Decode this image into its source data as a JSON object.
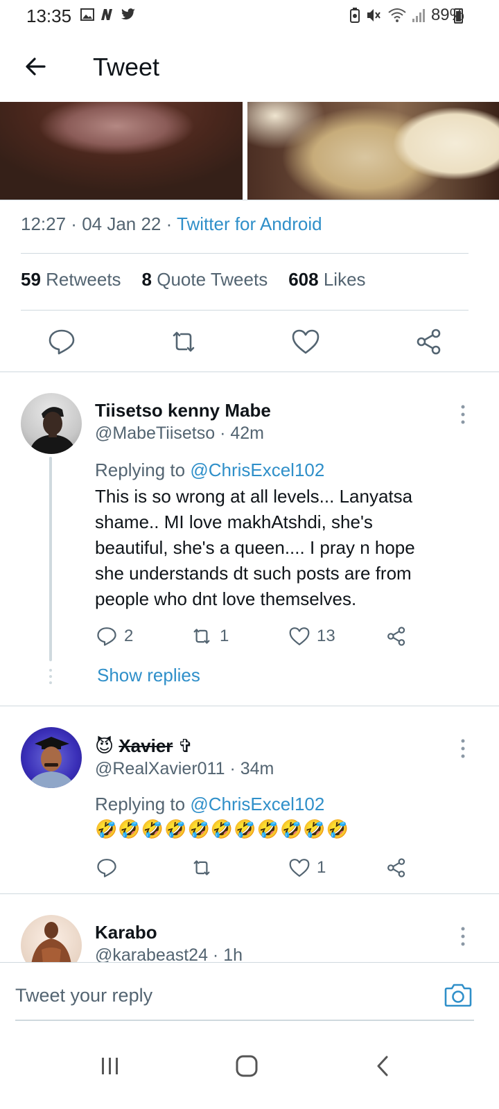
{
  "status_bar": {
    "time": "13:35",
    "battery_percent": "89%",
    "left_icons": [
      "gallery-icon",
      "n-app-icon",
      "twitter-bird-icon"
    ],
    "right_icons": [
      "battery-saver-icon",
      "mute-icon",
      "wifi-icon",
      "signal-icon",
      "battery-icon"
    ]
  },
  "app_bar": {
    "title": "Tweet",
    "back_icon": "arrow-left-icon"
  },
  "tweet": {
    "time": "12:27",
    "date": "04 Jan 22",
    "separator": " · ",
    "source": "Twitter for Android",
    "retweets_count": "59",
    "retweets_label": "Retweets",
    "quotes_count": "8",
    "quotes_label": "Quote Tweets",
    "likes_count": "608",
    "likes_label": "Likes",
    "actions": [
      "reply-icon",
      "retweet-icon",
      "like-icon",
      "share-icon"
    ]
  },
  "replies": [
    {
      "name": "Tiisetso kenny  Mabe",
      "handle": "@MabeTiisetso",
      "age": "42m",
      "replying_prefix": "Replying to ",
      "replying_to": "@ChrisExcel102",
      "text": "This is so wrong at all levels... Lanyatsa\nshame.. MI love makhAtshdi, she's\nbeautiful, she's a queen.... I pray n hope\nshe understands dt such posts are from\npeople who dnt love themselves.",
      "reply_count": "2",
      "retweet_count": "1",
      "like_count": "13",
      "show_replies": "Show replies"
    },
    {
      "name_emoji": "😈",
      "name": "Xavier",
      "name_suffix": "✞",
      "handle": "@RealXavier011",
      "age": "34m",
      "replying_prefix": "Replying to ",
      "replying_to": "@ChrisExcel102",
      "text": "🤣🤣🤣🤣🤣🤣🤣🤣🤣🤣🤣",
      "reply_count": "",
      "retweet_count": "",
      "like_count": "1"
    },
    {
      "name": "Karabo",
      "handle": "@karabeast24",
      "age": "1h"
    }
  ],
  "composer": {
    "placeholder": "Tweet your reply",
    "camera_icon": "camera-icon"
  },
  "nav_bar": {
    "buttons": [
      "recents-icon",
      "home-icon",
      "back-icon"
    ]
  },
  "colors": {
    "accent": "#2f8fc9",
    "secondary_text": "#536471",
    "primary_text": "#0f1419",
    "divider": "#cfd9de"
  }
}
